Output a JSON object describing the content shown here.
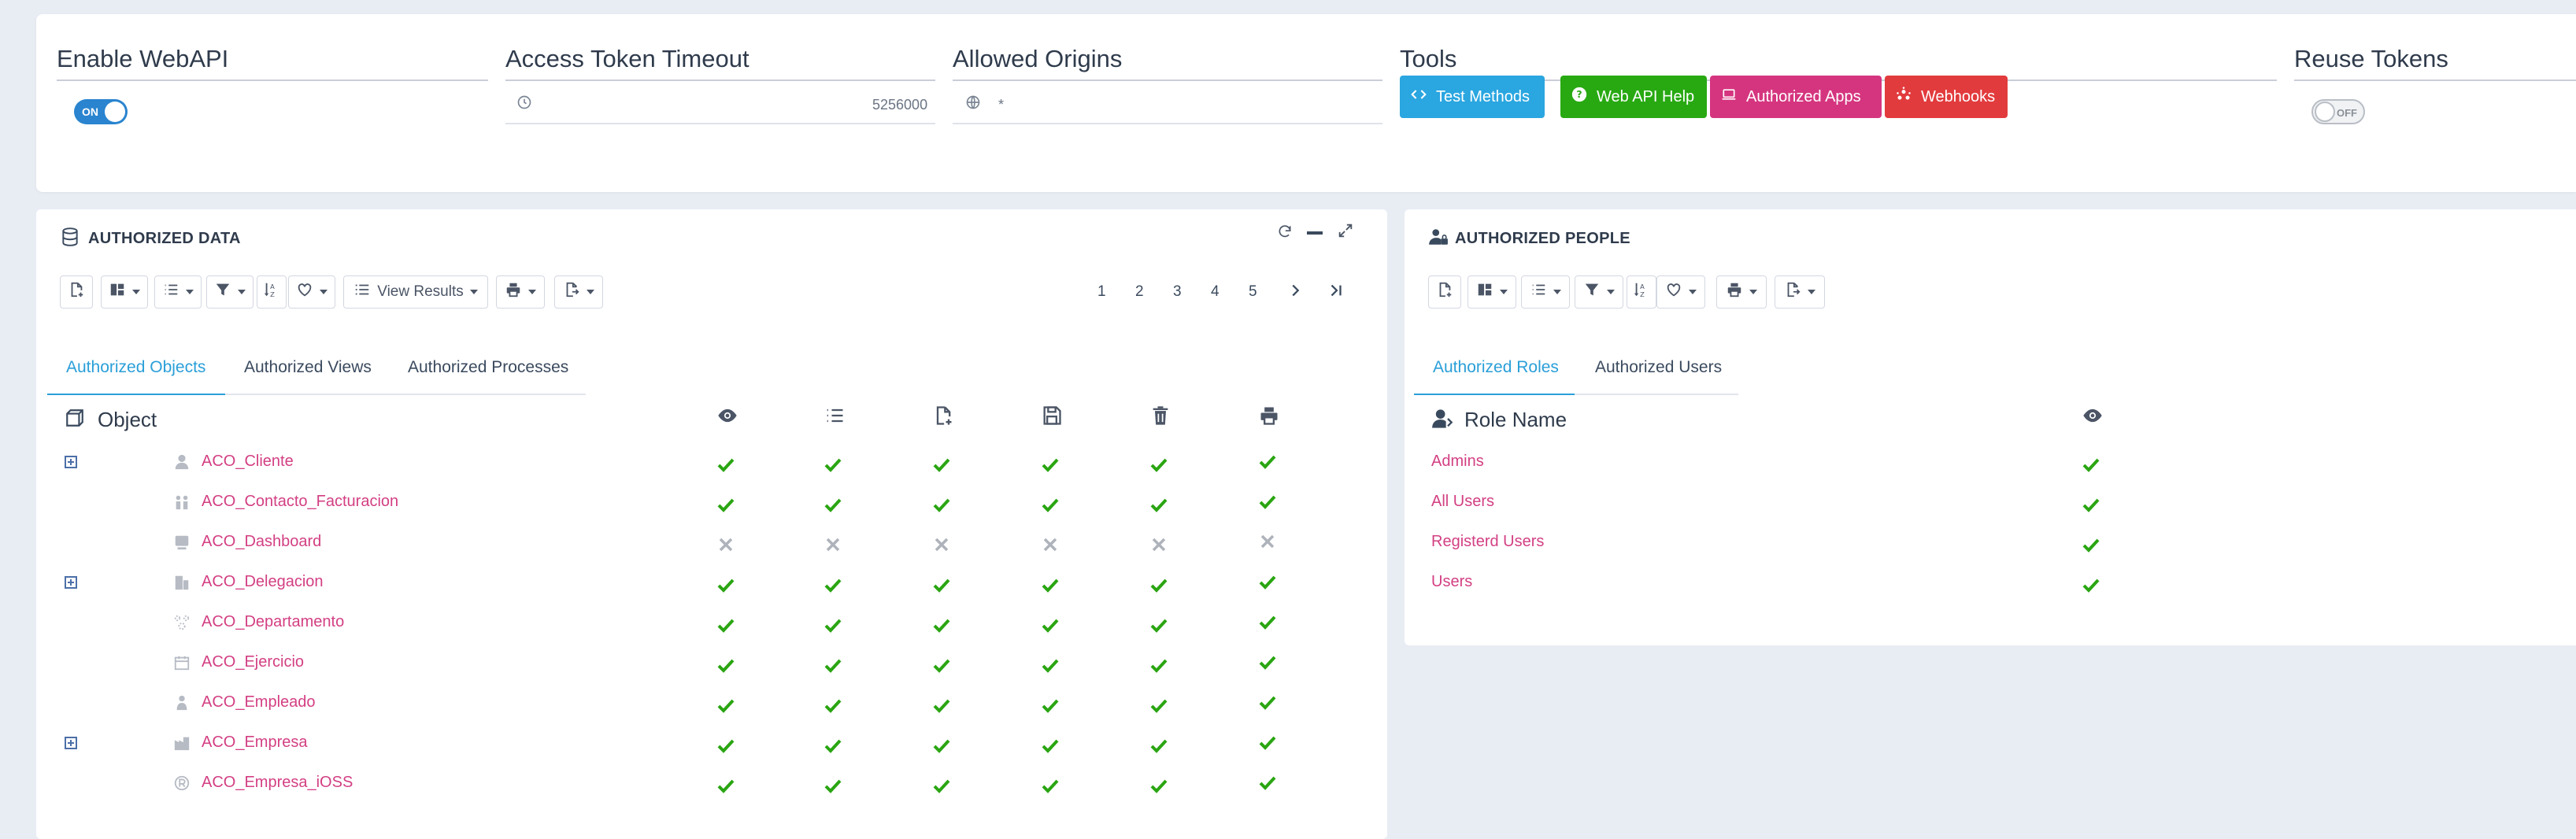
{
  "config": {
    "enable_webapi": {
      "label": "Enable WebAPI",
      "toggle": "ON"
    },
    "token_timeout": {
      "label": "Access Token Timeout",
      "value": "5256000"
    },
    "allowed_origins": {
      "label": "Allowed Origins",
      "value": "*"
    },
    "tools": {
      "label": "Tools",
      "buttons": [
        {
          "label": "Test Methods",
          "color": "#2aa6e0",
          "icon": "code-icon"
        },
        {
          "label": "Web API Help",
          "color": "#28a912",
          "icon": "question-circle-icon"
        },
        {
          "label": "Authorized Apps",
          "color": "#d5357f",
          "icon": "laptop-icon"
        },
        {
          "label": "Webhooks",
          "color": "#e23b3d",
          "icon": "webhook-icon"
        }
      ]
    },
    "reuse_tokens": {
      "label": "Reuse Tokens",
      "toggle": "OFF"
    }
  },
  "authorized_data": {
    "title": "AUTHORIZED DATA",
    "view_results_label": "View Results",
    "pager": [
      "1",
      "2",
      "3",
      "4",
      "5"
    ],
    "tabs": [
      "Authorized Objects",
      "Authorized Views",
      "Authorized Processes"
    ],
    "active_tab": 0,
    "object_header": "Object",
    "columns": [
      "eye-icon",
      "list-icon",
      "file-plus-icon",
      "save-icon",
      "trash-icon",
      "print-icon"
    ],
    "rows": [
      {
        "name": "ACO_Cliente",
        "icon": "user-icon",
        "expandable": true,
        "perms": [
          true,
          true,
          true,
          true,
          true,
          true
        ]
      },
      {
        "name": "ACO_Contacto_Facturacion",
        "icon": "contacts-icon",
        "expandable": false,
        "perms": [
          true,
          true,
          true,
          true,
          true,
          true
        ]
      },
      {
        "name": "ACO_Dashboard",
        "icon": "dashboard-icon",
        "expandable": false,
        "perms": [
          false,
          false,
          false,
          false,
          false,
          false
        ]
      },
      {
        "name": "ACO_Delegacion",
        "icon": "building-icon",
        "expandable": true,
        "perms": [
          true,
          true,
          true,
          true,
          true,
          true
        ]
      },
      {
        "name": "ACO_Departamento",
        "icon": "department-icon",
        "expandable": false,
        "perms": [
          true,
          true,
          true,
          true,
          true,
          true
        ]
      },
      {
        "name": "ACO_Ejercicio",
        "icon": "calendar-icon",
        "expandable": false,
        "perms": [
          true,
          true,
          true,
          true,
          true,
          true
        ]
      },
      {
        "name": "ACO_Empleado",
        "icon": "employee-icon",
        "expandable": false,
        "perms": [
          true,
          true,
          true,
          true,
          true,
          true
        ]
      },
      {
        "name": "ACO_Empresa",
        "icon": "company-icon",
        "expandable": true,
        "perms": [
          true,
          true,
          true,
          true,
          true,
          true
        ]
      },
      {
        "name": "ACO_Empresa_iOSS",
        "icon": "registered-icon",
        "expandable": false,
        "perms": [
          true,
          true,
          true,
          true,
          true,
          true
        ]
      }
    ]
  },
  "authorized_people": {
    "title": "AUTHORIZED PEOPLE",
    "tabs": [
      "Authorized Roles",
      "Authorized Users"
    ],
    "active_tab": 0,
    "role_header": "Role Name",
    "rows": [
      {
        "name": "Admins",
        "read": true
      },
      {
        "name": "All Users",
        "read": true
      },
      {
        "name": "Registerd Users",
        "read": true
      },
      {
        "name": "Users",
        "read": true
      }
    ]
  },
  "colors": {
    "check": "#2aa512",
    "cross": "#aeb3bb",
    "link": "#d33f83",
    "accent": "#2a9fd8"
  }
}
